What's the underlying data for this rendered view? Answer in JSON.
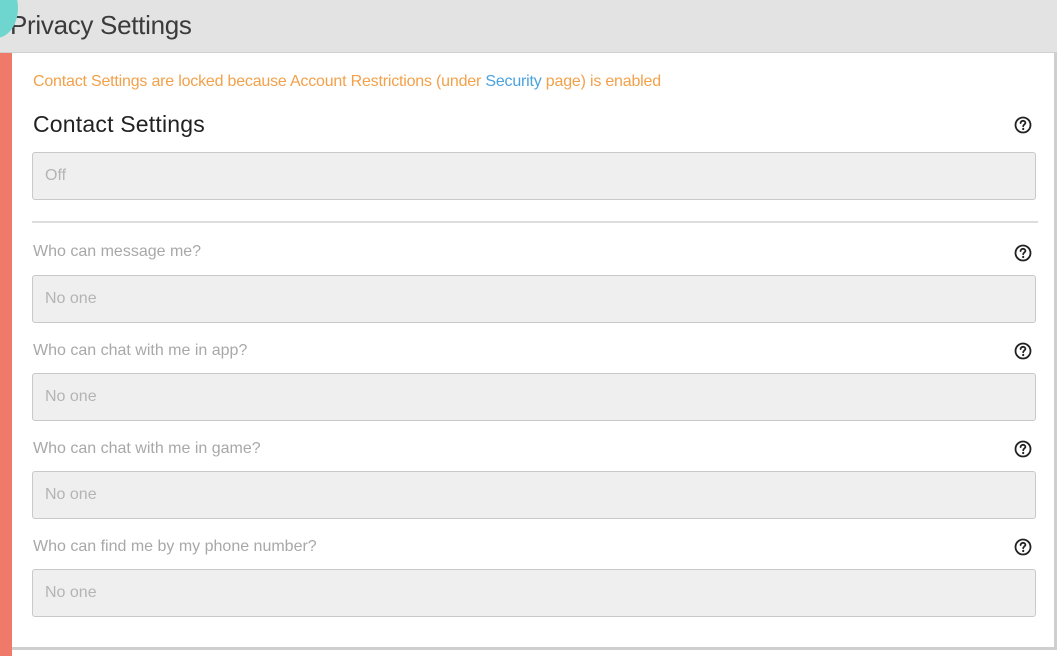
{
  "header": {
    "title": "Privacy Settings"
  },
  "notice": {
    "text_before": "Contact Settings are locked because Account Restrictions (under ",
    "link_text": "Security",
    "text_after": " page) is enabled"
  },
  "contact_settings": {
    "title": "Contact Settings",
    "value": "Off",
    "help_icon": "question-circle-icon"
  },
  "fields": [
    {
      "label": "Who can message me?",
      "value": "No one",
      "help_icon": "question-circle-icon"
    },
    {
      "label": "Who can chat with me in app?",
      "value": "No one",
      "help_icon": "question-circle-icon"
    },
    {
      "label": "Who can chat with me in game?",
      "value": "No one",
      "help_icon": "question-circle-icon"
    },
    {
      "label": "Who can find me by my phone number?",
      "value": "No one",
      "help_icon": "question-circle-icon"
    }
  ],
  "colors": {
    "notice": "#f2a14a",
    "link": "#4aa3df",
    "header_bg": "#e3e3e3",
    "disabled_field_bg": "#efefef",
    "left_stripe": "#f07a6a",
    "teal_accent": "#6fd6cf"
  }
}
